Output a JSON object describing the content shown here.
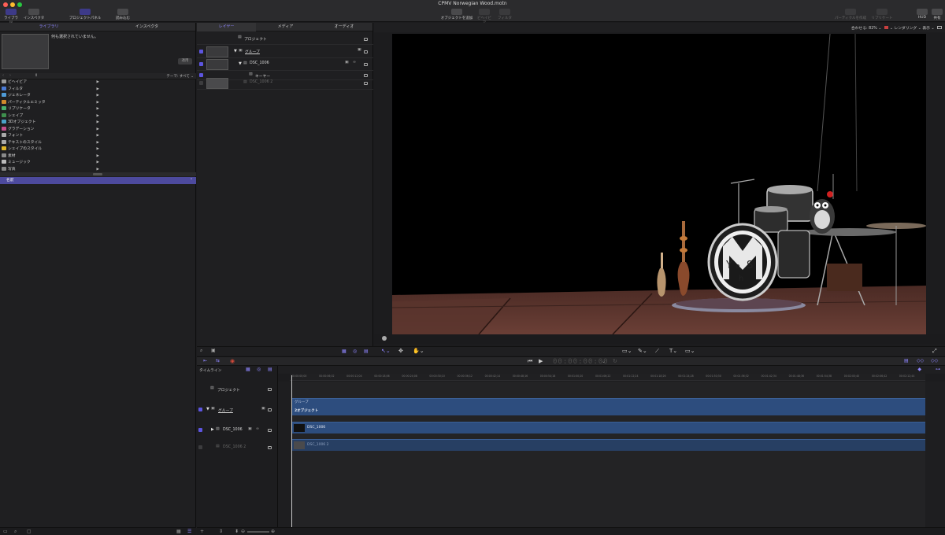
{
  "window": {
    "title": "CPMV Norwegian Wood.motn"
  },
  "toolbar": {
    "library_label": "ライブラリ",
    "inspector_label": "インスペクタ",
    "project_panel_label": "プロジェクトパネル",
    "import_label": "読み込む",
    "add_object_label": "オブジェクトを追加",
    "behaviors_label": "ビヘイビア",
    "filters_label": "フィルタ",
    "make_particles_label": "パーティクルを作成",
    "replicate_label": "リプリケート",
    "hud_label": "HUD",
    "share_label": "共有"
  },
  "left_pane": {
    "tabs": [
      "ライブラリ",
      "インスペクタ"
    ],
    "active_tab": 0,
    "no_selection": "何も選択されていません。",
    "apply_label": "適用",
    "theme_filter": "テーマ: すべて",
    "categories": [
      {
        "label": "ビヘイビア",
        "icon": "gear-icon",
        "color": "#9a9a9a"
      },
      {
        "label": "フィルタ",
        "icon": "filter-icon",
        "color": "#4b7bd6"
      },
      {
        "label": "ジェネレータ",
        "icon": "generator-icon",
        "color": "#4e9bd8"
      },
      {
        "label": "パーティクルエミッタ",
        "icon": "particle-icon",
        "color": "#d08a2c"
      },
      {
        "label": "リプリケータ",
        "icon": "replicator-icon",
        "color": "#49b06c"
      },
      {
        "label": "シェイプ",
        "icon": "shape-icon",
        "color": "#3e8f4d"
      },
      {
        "label": "3Dオブジェクト",
        "icon": "cube-icon",
        "color": "#4aa3c8"
      },
      {
        "label": "グラデーション",
        "icon": "gradient-icon",
        "color": "#c44f8c"
      },
      {
        "label": "フォント",
        "icon": "font-icon",
        "color": "#aaaaaa"
      },
      {
        "label": "テキストのスタイル",
        "icon": "text-style-icon",
        "color": "#aaaaaa"
      },
      {
        "label": "シェイプのスタイル",
        "icon": "shape-style-icon",
        "color": "#e0b628"
      },
      {
        "label": "素材",
        "icon": "material-icon",
        "color": "#8a8a8a"
      },
      {
        "label": "ミュージック",
        "icon": "music-icon",
        "color": "#bbbbbb"
      },
      {
        "label": "写真",
        "icon": "photo-icon",
        "color": "#888888"
      }
    ],
    "name_header": "名前"
  },
  "layers": {
    "tabs": [
      "レイヤー",
      "メディア",
      "オーディオ"
    ],
    "active_tab": 0,
    "rows": [
      {
        "label": "プロジェクト"
      },
      {
        "label": "グループ"
      },
      {
        "label": "DSC_1006"
      },
      {
        "label": "キーヤー"
      },
      {
        "label": "DSC_1006 2"
      }
    ]
  },
  "viewer": {
    "fit_label": "合わせる: 82%",
    "render_label": "レンダリング",
    "view_label": "表示"
  },
  "timeline": {
    "label": "タイムライン",
    "timecode": "00:00:00:00",
    "ruler_ticks": [
      "00:00:00;00",
      "00:00:06;02",
      "00:00:12;04",
      "00:00:18;06",
      "00:00:24;08",
      "00:00:30;10",
      "00:00:36;12",
      "00:00:42;14",
      "00:00:48;16",
      "00:00:54;18",
      "00:01:00;20",
      "00:01:06;22",
      "00:01:12;24",
      "00:01:18;26",
      "00:01:24;28",
      "00:01:30;30",
      "00:01:36;32",
      "00:01:42;34",
      "00:01:48;36",
      "00:01:54;38",
      "00:02:00;40",
      "00:02:06;42",
      "00:02:12;44"
    ],
    "rows": [
      {
        "label": "プロジェクト"
      },
      {
        "label": "グループ"
      },
      {
        "label": "DSC_1006"
      },
      {
        "label": "DSC_1006 2"
      }
    ],
    "bars": {
      "group_label": "グループ",
      "group_count": "2オブジェクト",
      "clip1_label": "DSC_1006",
      "clip2_label": "DSC_1006 2"
    }
  },
  "colors": {
    "accent": "#8f86ff",
    "clip": "#2d4d7e",
    "selection": "#4d4a9e"
  }
}
